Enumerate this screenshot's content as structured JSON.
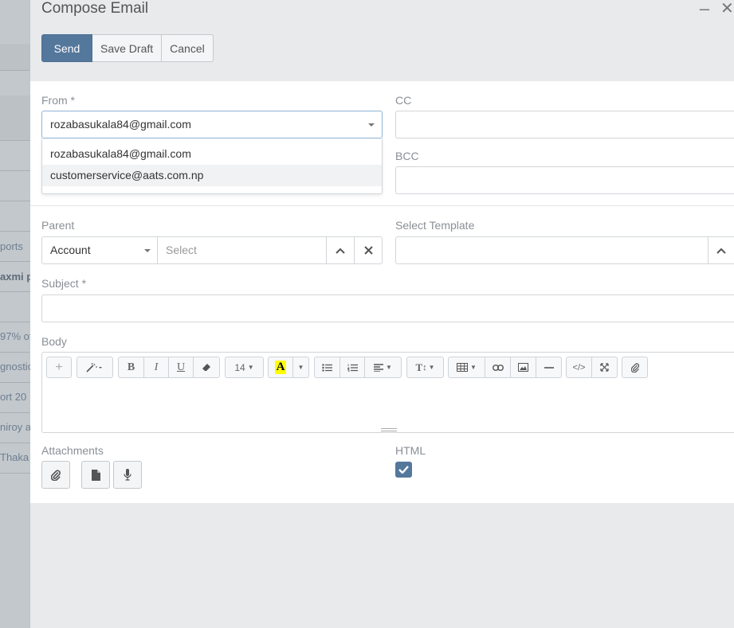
{
  "background": {
    "snippets": [
      "ports",
      "axmi p",
      "97% of",
      "gnostic",
      "ort 20",
      "niroy a",
      "Thaka"
    ]
  },
  "modal": {
    "title": "Compose Email",
    "actions": {
      "send": "Send",
      "save_draft": "Save Draft",
      "cancel": "Cancel"
    },
    "from": {
      "label": "From *",
      "value": "rozabasukala84@gmail.com",
      "options": [
        "rozabasukala84@gmail.com",
        "customerservice@aats.com.np"
      ]
    },
    "cc": {
      "label": "CC",
      "value": ""
    },
    "bcc": {
      "label": "BCC",
      "value": ""
    },
    "parent": {
      "label": "Parent",
      "type_value": "Account",
      "placeholder": "Select"
    },
    "template": {
      "label": "Select Template",
      "value": ""
    },
    "subject": {
      "label": "Subject *",
      "value": ""
    },
    "body": {
      "label": "Body",
      "font_size": "14",
      "highlight_letter": "A",
      "text_style_letter": "T",
      "code_label": "</>"
    },
    "attachments": {
      "label": "Attachments"
    },
    "html": {
      "label": "HTML",
      "checked": true
    }
  },
  "colors": {
    "primary": "#54779c",
    "panel": "#ffffff",
    "modal_bg": "#e8eaec",
    "highlight_yellow": "#ffff00"
  }
}
